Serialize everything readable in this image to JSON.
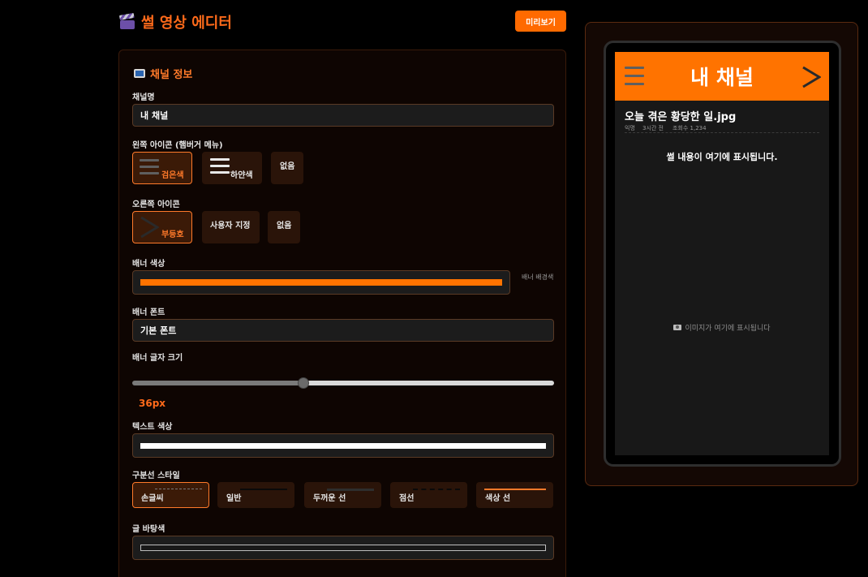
{
  "app": {
    "title": "썰 영상 에디터",
    "preview_button": "미리보기"
  },
  "channel": {
    "section_title": "채널 정보",
    "name_label": "채널명",
    "name_value": "내 채널",
    "left_icon_label": "왼쪽 아이콘 (햄버거 메뉴)",
    "left_icon_options": [
      "검은색",
      "하얀색",
      "없음"
    ],
    "left_icon_selected": "검은색",
    "right_icon_label": "오른쪽 아이콘",
    "right_icon_options": [
      "부등호",
      "사용자 지정",
      "없음"
    ],
    "right_icon_selected": "부등호",
    "banner_color_label": "배너 색상",
    "banner_color_value": "#ff7300",
    "banner_color_hint": "배너 배경색",
    "banner_font_label": "배너 폰트",
    "banner_font_value": "기본 폰트",
    "banner_size_label": "배너 글자 크기",
    "banner_size_value": "36px",
    "banner_size_fraction": 0.4,
    "text_color_label": "텍스트 색상",
    "text_color_value": "#ffffff",
    "divider_label": "구분선 스타일",
    "divider_options": [
      "손글씨",
      "일반",
      "두꺼운 선",
      "점선",
      "색상 선"
    ],
    "divider_selected": "손글씨",
    "post_bg_label": "글 바탕색",
    "post_bg_value": "#181818"
  },
  "preview": {
    "banner_title": "내 채널",
    "post_title": "오늘 겪은 황당한 일.jpg",
    "meta_author": "익명",
    "meta_time": "3시간 전",
    "meta_views": "조회수 1,234",
    "content_placeholder": "썰 내용이 여기에 표시됩니다.",
    "image_placeholder": "이미지가 여기에 표시됩니다"
  },
  "colors": {
    "accent": "#ff6a00",
    "banner": "#ff7300",
    "panel_bg": "#0e0502",
    "border": "#5a3a25"
  },
  "icons": [
    "clapperboard-icon",
    "tv-icon",
    "hamburger-icon",
    "chevron-right-icon",
    "camera-icon"
  ]
}
